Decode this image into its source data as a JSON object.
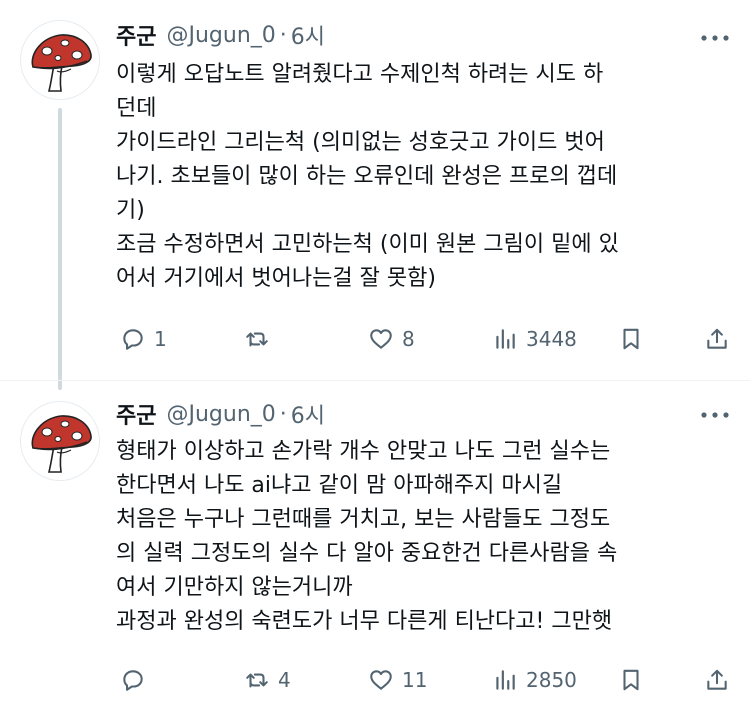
{
  "tweets": [
    {
      "author": {
        "name": "주군",
        "handle": "@Jugun_0",
        "separator": "·",
        "time": "6시"
      },
      "lines": [
        "이렇게 오답노트 알려줬다고 수제인척 하려는 시도 하",
        "던데",
        "가이드라인 그리는척 (의미없는 성호긋고 가이드 벗어",
        "나기. 초보들이 많이 하는 오류인데 완성은 프로의 껍데",
        "기)",
        "조금 수정하면서 고민하는척 (이미 원본 그림이 밑에 있",
        "어서 거기에서 벗어나는걸 잘 못함)"
      ],
      "stats": {
        "replies": "1",
        "retweets": "",
        "likes": "8",
        "views": "3448"
      }
    },
    {
      "author": {
        "name": "주군",
        "handle": "@Jugun_0",
        "separator": "·",
        "time": "6시"
      },
      "lines": [
        "형태가 이상하고 손가락 개수 안맞고 나도 그런 실수는",
        "한다면서 나도 ai냐고 같이 맘 아파해주지 마시길",
        "처음은 누구나 그런때를 거치고, 보는 사람들도 그정도",
        "의 실력 그정도의 실수 다 알아 중요한건 다른사람을 속",
        "여서 기만하지 않는거니까",
        "과정과 완성의 숙련도가 너무 다른게 티난다고! 그만햇"
      ],
      "stats": {
        "replies": "",
        "retweets": "4",
        "likes": "11",
        "views": "2850"
      }
    }
  ],
  "icons": {
    "avatar": "mushroom-avatar",
    "more": "more-icon",
    "reply": "reply-icon",
    "retweet": "retweet-icon",
    "like": "heart-icon",
    "views": "views-icon",
    "bookmark": "bookmark-icon",
    "share": "share-icon"
  },
  "colors": {
    "text": "#0f1419",
    "secondary": "#536471",
    "thread_line": "#cfd9de",
    "mushroom_cap": "#c0362c"
  }
}
